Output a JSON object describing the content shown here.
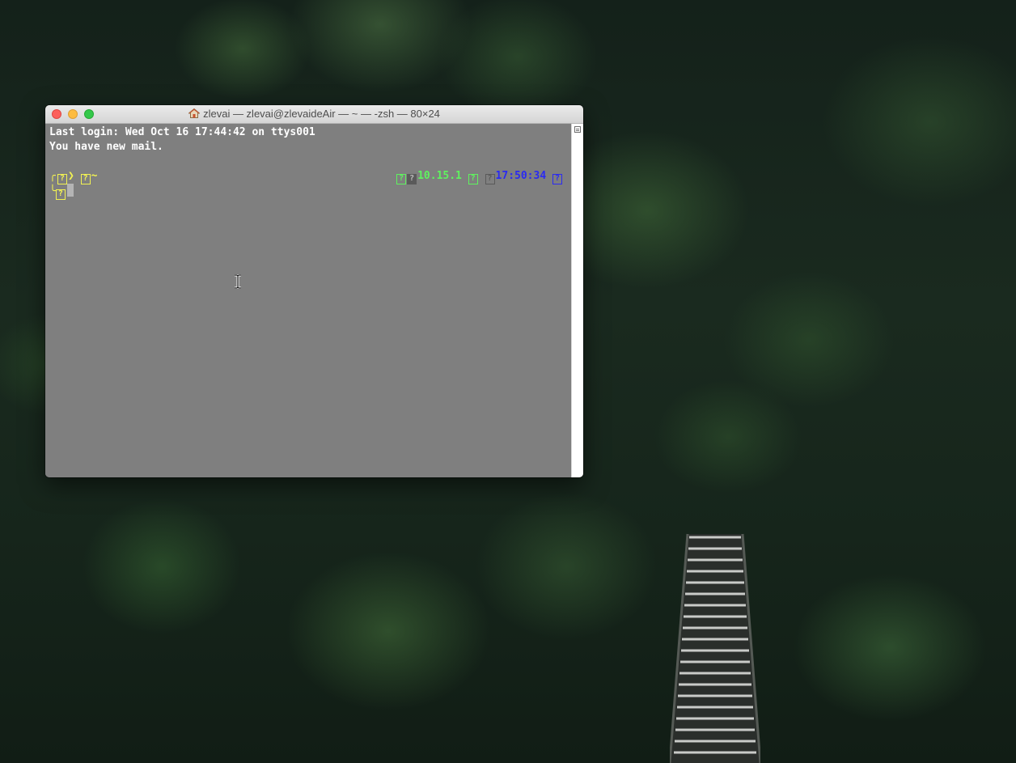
{
  "window": {
    "title": "zlevai — zlevai@zlevaideAir — ~ — -zsh — 80×24",
    "home_icon": "home-icon"
  },
  "terminal": {
    "lines": [
      "Last login: Wed Oct 16 17:44:42 on ttys001",
      "You have new mail."
    ],
    "prompt": {
      "corner_top": "╭",
      "corner_bottom": "╰",
      "glyph": "?",
      "arrow": "❯",
      "cwd": "~",
      "os_version": "10.15.1",
      "time": "17:50:34"
    },
    "colors": {
      "background": "#7f7f7f",
      "text": "#ffffff",
      "yellow": "#f2f252",
      "green": "#5ff25f",
      "blue": "#2a2af2"
    }
  }
}
